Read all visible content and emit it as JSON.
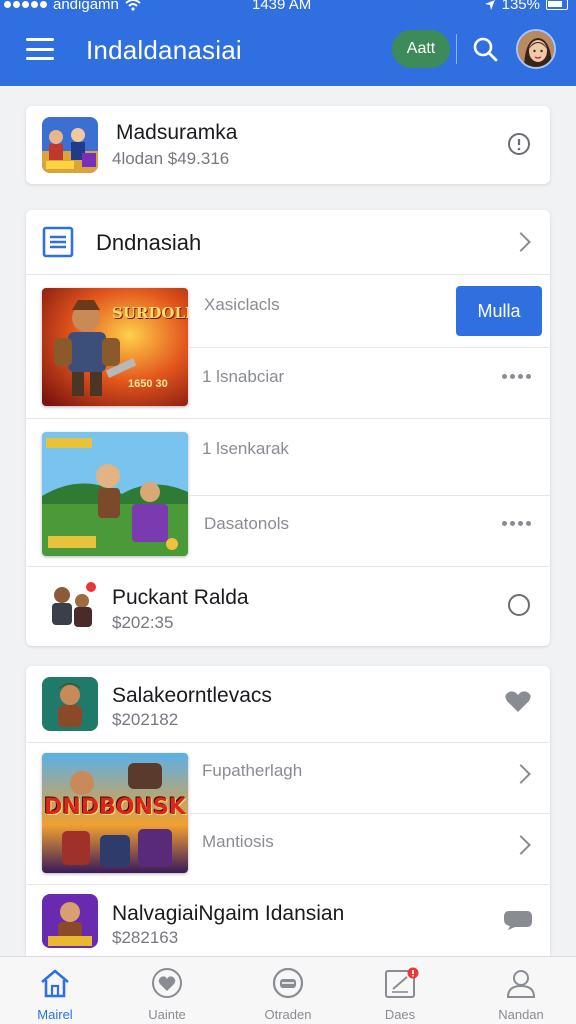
{
  "status_bar": {
    "carrier": "andigamn",
    "time": "1439 AM",
    "battery": "135%"
  },
  "app_bar": {
    "title": "Indaldanasiai",
    "pill_label": "Aatt"
  },
  "card1": {
    "title": "Madsuramka",
    "subtitle": "4lodan $49.316"
  },
  "card2": {
    "header": "Dndnasiah",
    "game1": {
      "label_top": "Xasiclacls",
      "button_label": "Mulla",
      "label_bottom": "1 lsnabciar",
      "art_text": "SURDOLL",
      "art_sub": "1650 30"
    },
    "game2": {
      "label_top": "1 lsenkarak",
      "label_bottom": "Dasatonols"
    },
    "item": {
      "title": "Puckant Ralda",
      "subtitle": "$202:35"
    }
  },
  "card3": {
    "item1": {
      "title": "Salakeorntlevacs",
      "subtitle": "$202182"
    },
    "game": {
      "label_top": "Fupatherlagh",
      "label_bottom": "Mantiosis",
      "art_text": "DNDBONSK"
    },
    "item2": {
      "title": "NalvagiaiNgaim Idansian",
      "subtitle": "$282163"
    }
  },
  "bottom_nav": [
    {
      "label": "Mairel",
      "icon": "home-icon"
    },
    {
      "label": "Uainte",
      "icon": "heart-icon"
    },
    {
      "label": "Otraden",
      "icon": "chat-icon"
    },
    {
      "label": "Daes",
      "icon": "notes-icon"
    },
    {
      "label": "Nandan",
      "icon": "profile-icon"
    }
  ],
  "colors": {
    "primary": "#2f6fe0",
    "pill": "#3d8a5a",
    "badge": "#e53935"
  }
}
